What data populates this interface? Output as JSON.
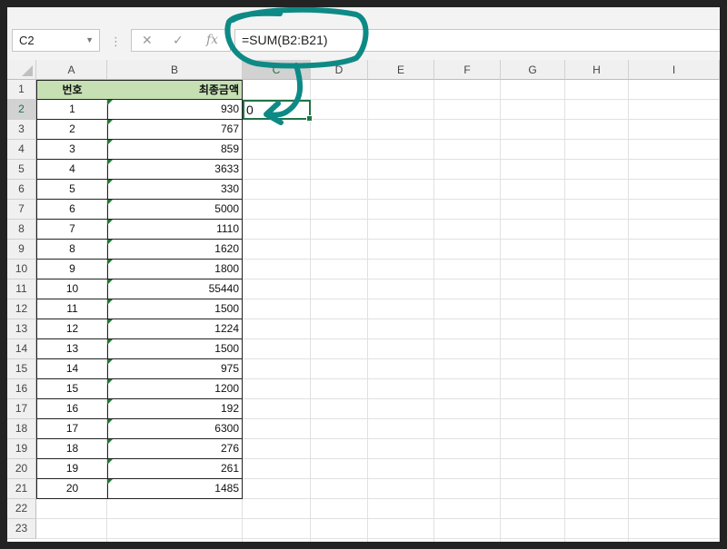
{
  "formula_bar": {
    "name_box": "C2",
    "formula": "=SUM(B2:B21)",
    "cancel_icon": "✕",
    "enter_icon": "✓",
    "function_icon": "fx"
  },
  "columns": [
    "A",
    "B",
    "C",
    "D",
    "E",
    "F",
    "G",
    "H",
    "I"
  ],
  "rows": [
    "1",
    "2",
    "3",
    "4",
    "5",
    "6",
    "7",
    "8",
    "9",
    "10",
    "11",
    "12",
    "13",
    "14",
    "15",
    "16",
    "17",
    "18",
    "19",
    "20",
    "21",
    "22",
    "23"
  ],
  "active_cell": {
    "ref": "C2",
    "value": "0"
  },
  "table": {
    "headers": [
      "번호",
      "최종금액"
    ],
    "rows": [
      [
        "1",
        "930"
      ],
      [
        "2",
        "767"
      ],
      [
        "3",
        "859"
      ],
      [
        "4",
        "3633"
      ],
      [
        "5",
        "330"
      ],
      [
        "6",
        "5000"
      ],
      [
        "7",
        "1110"
      ],
      [
        "8",
        "1620"
      ],
      [
        "9",
        "1800"
      ],
      [
        "10",
        "55440"
      ],
      [
        "11",
        "1500"
      ],
      [
        "12",
        "1224"
      ],
      [
        "13",
        "1500"
      ],
      [
        "14",
        "975"
      ],
      [
        "15",
        "1200"
      ],
      [
        "16",
        "192"
      ],
      [
        "17",
        "6300"
      ],
      [
        "18",
        "276"
      ],
      [
        "19",
        "261"
      ],
      [
        "20",
        "1485"
      ]
    ]
  },
  "colors": {
    "header_fill": "#c6e0b4",
    "selection_green": "#217346",
    "annotation_teal": "#0e8a86",
    "text_as_number_flag": "#1e7b34"
  }
}
